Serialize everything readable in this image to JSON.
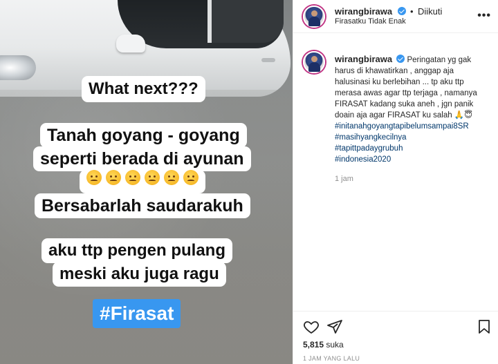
{
  "story": {
    "lines": {
      "what_next": "What next???",
      "tanah_1": "Tanah goyang - goyang",
      "tanah_2": "seperti berada di ayunan",
      "bersabar": "Bersabarlah saudarakuh",
      "pulang_1": "aku ttp pengen pulang",
      "pulang_2": "meski aku juga ragu",
      "hashtag": "#Firasat"
    },
    "emojis": [
      "confounded-face",
      "tired-face",
      "crying-face",
      "pensive-face",
      "confounded-face",
      "worried-face"
    ]
  },
  "post": {
    "username": "wirangbirawa",
    "follow_state": "Diikuti",
    "separator": "•",
    "location": "Firasatku Tidak Enak",
    "more_icon": "more-horizontal-icon"
  },
  "caption": {
    "username": "wirangbirawa",
    "text": "Peringatan yg gak harus di khawatirkan , anggap aja halusinasi ku berlebihan ... tp aku ttp merasa awas agar ttp terjaga , namanya FIRASAT kadang suka aneh , jgn panik doain aja agar FIRASAT ku salah 🙏😇",
    "hashtags": [
      "#initanahgoyangtapibelumsampai8SR",
      "#masihyangkecilnya",
      "#tapittpadaygrubuh",
      "#indonesia2020"
    ],
    "time": "1 jam"
  },
  "actions": {
    "like_icon": "heart-icon",
    "share_icon": "send-icon",
    "save_icon": "bookmark-icon"
  },
  "likes": {
    "count": "5,815",
    "label": "suka"
  },
  "post_time": "1 JAM YANG LALU",
  "colors": {
    "link": "#00376b",
    "verified": "#3897f0",
    "hashtag_bg": "#3897f0",
    "muted": "#8e8e8e"
  }
}
